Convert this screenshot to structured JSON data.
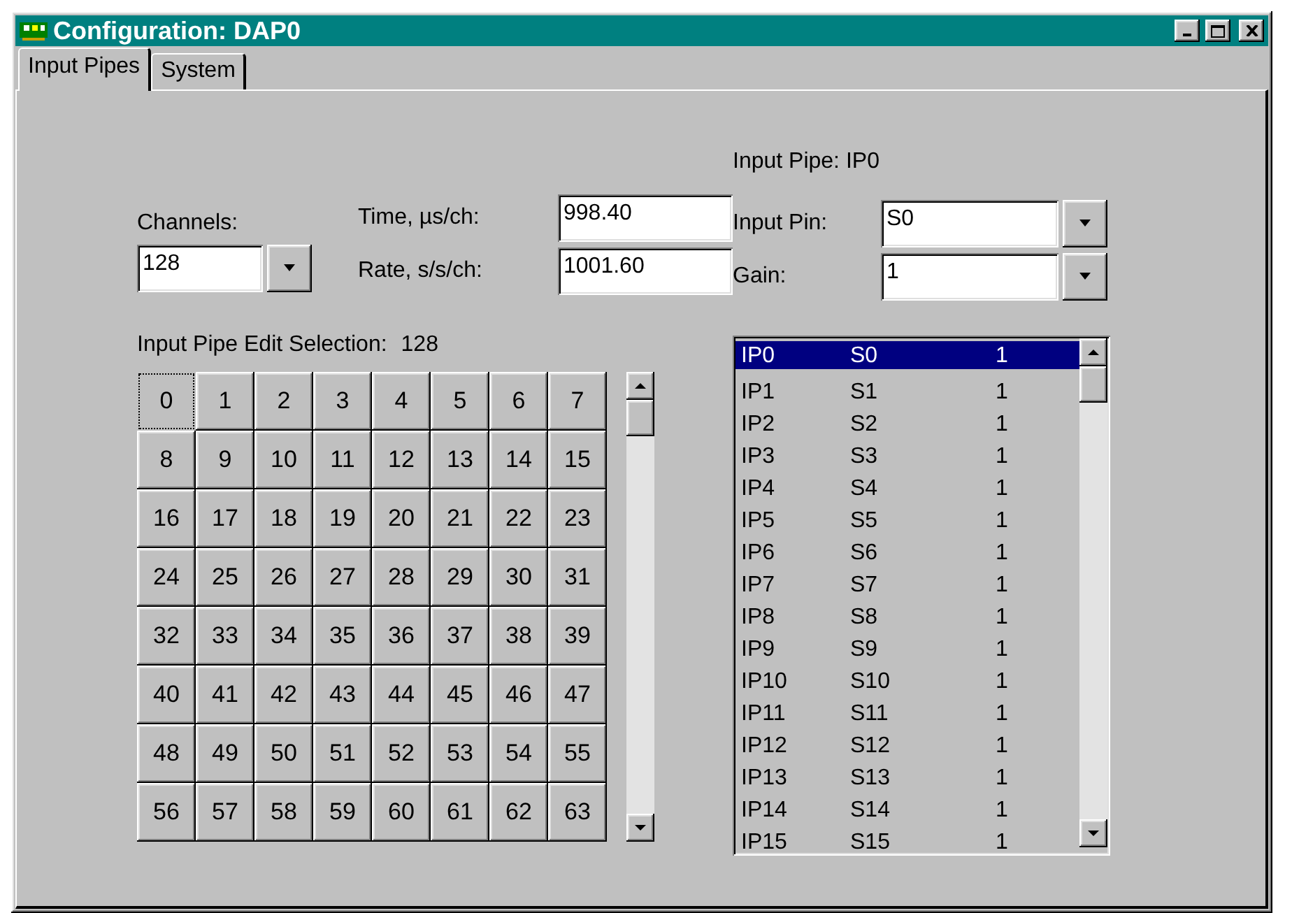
{
  "window": {
    "title": "Configuration: DAP0"
  },
  "tabs": [
    {
      "label": "Input Pipes",
      "selected": true
    },
    {
      "label": "System",
      "selected": false
    }
  ],
  "channels": {
    "label": "Channels:",
    "value": "128"
  },
  "time": {
    "label": "Time, µs/ch:",
    "value": "998.40"
  },
  "rate": {
    "label": "Rate, s/s/ch:",
    "value": "1001.60"
  },
  "selection": {
    "label": "Input Pipe Edit Selection:",
    "count": "128",
    "cells": [
      {
        "label": "0",
        "focused": true
      },
      {
        "label": "1",
        "focused": false
      },
      {
        "label": "2",
        "focused": false
      },
      {
        "label": "3",
        "focused": false
      },
      {
        "label": "4",
        "focused": false
      },
      {
        "label": "5",
        "focused": false
      },
      {
        "label": "6",
        "focused": false
      },
      {
        "label": "7",
        "focused": false
      },
      {
        "label": "8",
        "focused": false
      },
      {
        "label": "9",
        "focused": false
      },
      {
        "label": "10",
        "focused": false
      },
      {
        "label": "11",
        "focused": false
      },
      {
        "label": "12",
        "focused": false
      },
      {
        "label": "13",
        "focused": false
      },
      {
        "label": "14",
        "focused": false
      },
      {
        "label": "15",
        "focused": false
      },
      {
        "label": "16",
        "focused": false
      },
      {
        "label": "17",
        "focused": false
      },
      {
        "label": "18",
        "focused": false
      },
      {
        "label": "19",
        "focused": false
      },
      {
        "label": "20",
        "focused": false
      },
      {
        "label": "21",
        "focused": false
      },
      {
        "label": "22",
        "focused": false
      },
      {
        "label": "23",
        "focused": false
      },
      {
        "label": "24",
        "focused": false
      },
      {
        "label": "25",
        "focused": false
      },
      {
        "label": "26",
        "focused": false
      },
      {
        "label": "27",
        "focused": false
      },
      {
        "label": "28",
        "focused": false
      },
      {
        "label": "29",
        "focused": false
      },
      {
        "label": "30",
        "focused": false
      },
      {
        "label": "31",
        "focused": false
      },
      {
        "label": "32",
        "focused": false
      },
      {
        "label": "33",
        "focused": false
      },
      {
        "label": "34",
        "focused": false
      },
      {
        "label": "35",
        "focused": false
      },
      {
        "label": "36",
        "focused": false
      },
      {
        "label": "37",
        "focused": false
      },
      {
        "label": "38",
        "focused": false
      },
      {
        "label": "39",
        "focused": false
      },
      {
        "label": "40",
        "focused": false
      },
      {
        "label": "41",
        "focused": false
      },
      {
        "label": "42",
        "focused": false
      },
      {
        "label": "43",
        "focused": false
      },
      {
        "label": "44",
        "focused": false
      },
      {
        "label": "45",
        "focused": false
      },
      {
        "label": "46",
        "focused": false
      },
      {
        "label": "47",
        "focused": false
      },
      {
        "label": "48",
        "focused": false
      },
      {
        "label": "49",
        "focused": false
      },
      {
        "label": "50",
        "focused": false
      },
      {
        "label": "51",
        "focused": false
      },
      {
        "label": "52",
        "focused": false
      },
      {
        "label": "53",
        "focused": false
      },
      {
        "label": "54",
        "focused": false
      },
      {
        "label": "55",
        "focused": false
      },
      {
        "label": "56",
        "focused": false
      },
      {
        "label": "57",
        "focused": false
      },
      {
        "label": "58",
        "focused": false
      },
      {
        "label": "59",
        "focused": false
      },
      {
        "label": "60",
        "focused": false
      },
      {
        "label": "61",
        "focused": false
      },
      {
        "label": "62",
        "focused": false
      },
      {
        "label": "63",
        "focused": false
      }
    ]
  },
  "input_pipe": {
    "label": "Input Pipe: IP0"
  },
  "input_pin": {
    "label": "Input Pin:",
    "value": "S0"
  },
  "gain": {
    "label": "Gain:",
    "value": "1"
  },
  "pipe_list": {
    "rows": [
      {
        "pipe": "IP0",
        "pin": "S0",
        "gain": "1",
        "selected": true
      },
      {
        "pipe": "IP1",
        "pin": "S1",
        "gain": "1",
        "selected": false
      },
      {
        "pipe": "IP2",
        "pin": "S2",
        "gain": "1",
        "selected": false
      },
      {
        "pipe": "IP3",
        "pin": "S3",
        "gain": "1",
        "selected": false
      },
      {
        "pipe": "IP4",
        "pin": "S4",
        "gain": "1",
        "selected": false
      },
      {
        "pipe": "IP5",
        "pin": "S5",
        "gain": "1",
        "selected": false
      },
      {
        "pipe": "IP6",
        "pin": "S6",
        "gain": "1",
        "selected": false
      },
      {
        "pipe": "IP7",
        "pin": "S7",
        "gain": "1",
        "selected": false
      },
      {
        "pipe": "IP8",
        "pin": "S8",
        "gain": "1",
        "selected": false
      },
      {
        "pipe": "IP9",
        "pin": "S9",
        "gain": "1",
        "selected": false
      },
      {
        "pipe": "IP10",
        "pin": "S10",
        "gain": "1",
        "selected": false
      },
      {
        "pipe": "IP11",
        "pin": "S11",
        "gain": "1",
        "selected": false
      },
      {
        "pipe": "IP12",
        "pin": "S12",
        "gain": "1",
        "selected": false
      },
      {
        "pipe": "IP13",
        "pin": "S13",
        "gain": "1",
        "selected": false
      },
      {
        "pipe": "IP14",
        "pin": "S14",
        "gain": "1",
        "selected": false
      },
      {
        "pipe": "IP15",
        "pin": "S15",
        "gain": "1",
        "selected": false
      }
    ]
  }
}
